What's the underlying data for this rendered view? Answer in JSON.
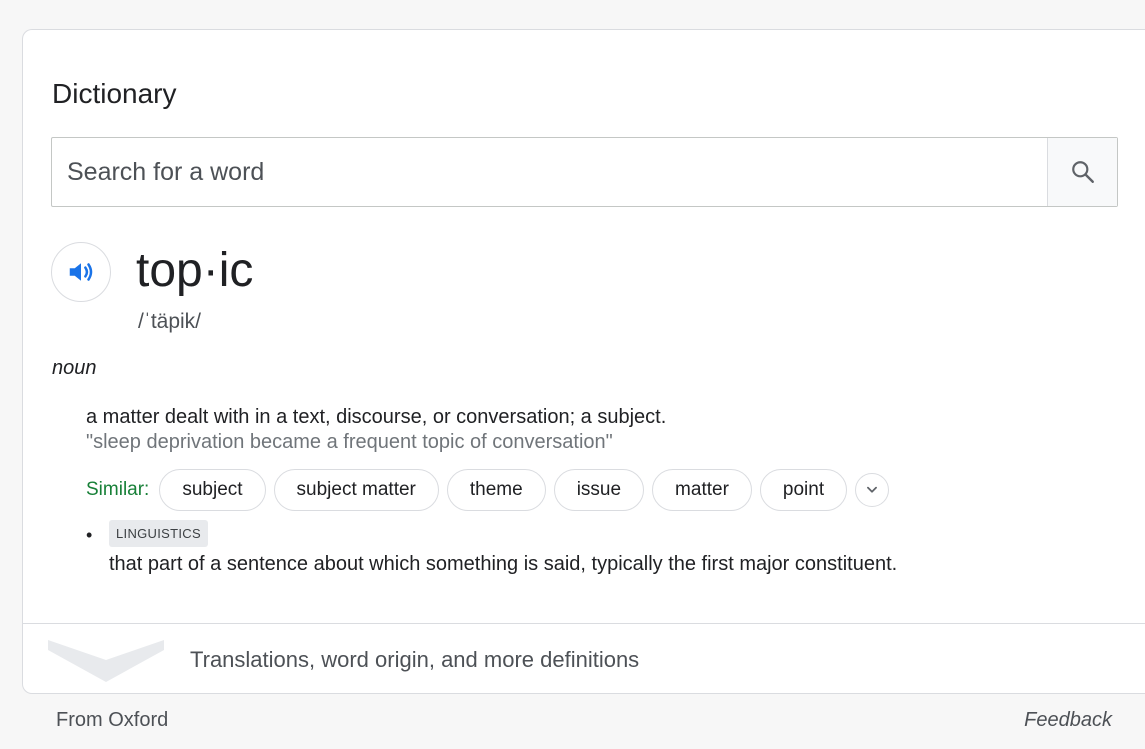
{
  "card": {
    "title": "Dictionary"
  },
  "search": {
    "placeholder": "Search for a word",
    "value": ""
  },
  "entry": {
    "headword": "top·ic",
    "phonetic": "/ˈtäpik/",
    "part_of_speech": "noun",
    "senses": [
      {
        "definition": "a matter dealt with in a text, discourse, or conversation; a subject.",
        "example": "\"sleep deprivation became a frequent topic of conversation\"",
        "similar_label": "Similar:",
        "similar": [
          "subject",
          "subject matter",
          "theme",
          "issue",
          "matter",
          "point"
        ]
      },
      {
        "bullet": "•",
        "domain": "LINGUISTICS",
        "definition": "that part of a sentence about which something is said, typically the first major constituent."
      }
    ]
  },
  "more": {
    "label": "Translations, word origin, and more definitions"
  },
  "footer": {
    "source": "From Oxford",
    "feedback": "Feedback"
  },
  "icons": {
    "search": "search-icon",
    "speaker": "speaker-icon",
    "expand_similar": "chevron-down-icon",
    "expand_more": "chevron-down-icon"
  },
  "colors": {
    "accent_blue": "#1a73e8",
    "similar_green": "#188038",
    "muted_text": "#70757a"
  }
}
